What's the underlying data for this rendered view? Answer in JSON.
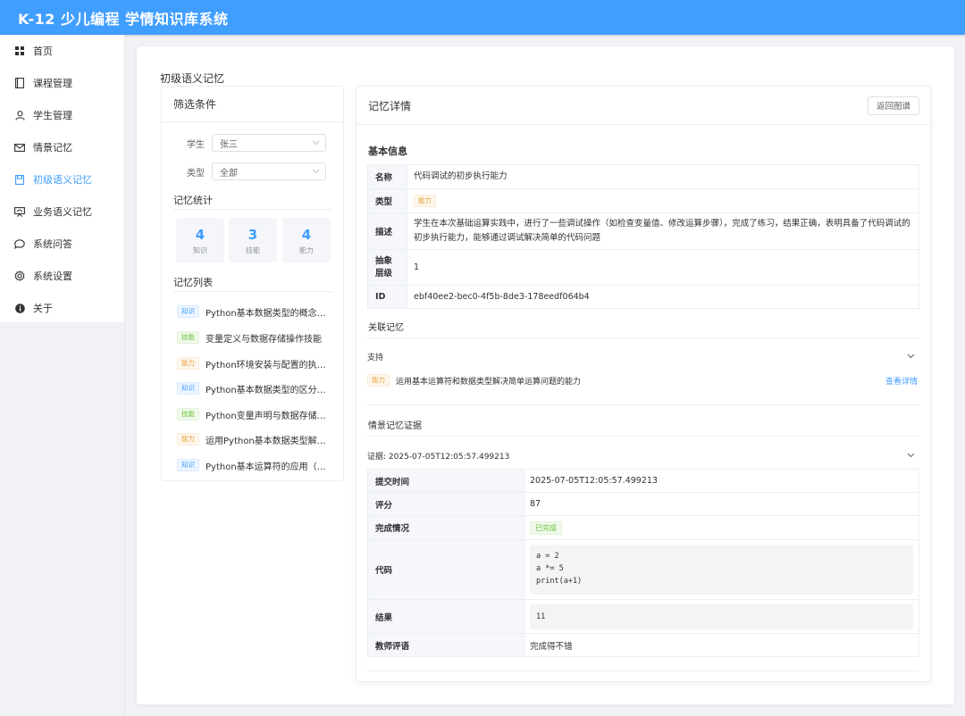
{
  "header": {
    "title": "K-12 少儿编程 学情知识库系统"
  },
  "sidebar": {
    "items": [
      {
        "label": "首页",
        "icon": "grid-icon",
        "active": false
      },
      {
        "label": "课程管理",
        "icon": "book-icon",
        "active": false
      },
      {
        "label": "学生管理",
        "icon": "user-icon",
        "active": false
      },
      {
        "label": "情景记忆",
        "icon": "mail-icon",
        "active": false
      },
      {
        "label": "初级语义记忆",
        "icon": "save-icon",
        "active": true
      },
      {
        "label": "业务语义记忆",
        "icon": "presentation-icon",
        "active": false
      },
      {
        "label": "系统问答",
        "icon": "chat-icon",
        "active": false
      },
      {
        "label": "系统设置",
        "icon": "gear-icon",
        "active": false
      },
      {
        "label": "关于",
        "icon": "info-icon",
        "active": false
      }
    ]
  },
  "page": {
    "title": "初级语义记忆"
  },
  "filter": {
    "title": "筛选条件",
    "student_label": "学生",
    "student_value": "张三",
    "type_label": "类型",
    "type_value": "全部"
  },
  "stats": {
    "title": "记忆统计",
    "items": [
      {
        "value": "4",
        "label": "知识"
      },
      {
        "value": "3",
        "label": "技能"
      },
      {
        "value": "4",
        "label": "能力"
      }
    ]
  },
  "memory_list": {
    "title": "记忆列表",
    "items": [
      {
        "tag": "知识",
        "kind": "k",
        "text": "Python基本数据类型的概念与..."
      },
      {
        "tag": "技能",
        "kind": "s",
        "text": "变量定义与数据存储操作技能"
      },
      {
        "tag": "能力",
        "kind": "a",
        "text": "Python环境安装与配置的执行..."
      },
      {
        "tag": "知识",
        "kind": "k",
        "text": "Python基本数据类型的区分与..."
      },
      {
        "tag": "技能",
        "kind": "s",
        "text": "Python变量声明与数据存储操作"
      },
      {
        "tag": "能力",
        "kind": "a",
        "text": "运用Python基本数据类型解决..."
      },
      {
        "tag": "知识",
        "kind": "k",
        "text": "Python基本运算符的应用（数..."
      }
    ]
  },
  "detail": {
    "title": "记忆详情",
    "back_button": "返回图谱",
    "basic_title": "基本信息",
    "basic": {
      "name_label": "名称",
      "name_value": "代码调试的初步执行能力",
      "type_label": "类型",
      "type_value": "能力",
      "desc_label": "描述",
      "desc_value": "学生在本次基础运算实践中，进行了一些调试操作（如检查变量值、修改运算步骤），完成了练习，结果正确，表明具备了代码调试的初步执行能力，能够通过调试解决简单的代码问题",
      "level_label": "抽象层级",
      "level_value": "1",
      "id_label": "ID",
      "id_value": "ebf40ee2-bec0-4f5b-8de3-178eedf064b4"
    },
    "related_title": "关联记忆",
    "related_group": "支持",
    "related_tag": "能力",
    "related_text": "运用基本运算符和数据类型解决简单运算问题的能力",
    "related_link": "查看详情",
    "evidence_title": "情景记忆证据",
    "evidence_group": "证据: 2025-07-05T12:05:57.499213",
    "evidence": {
      "submit_label": "提交时间",
      "submit_value": "2025-07-05T12:05:57.499213",
      "score_label": "评分",
      "score_value": "87",
      "status_label": "完成情况",
      "status_value": "已完成",
      "code_label": "代码",
      "code_value": "a = 2\na *= 5\nprint(a+1)",
      "result_label": "结果",
      "result_value": "11",
      "comment_label": "教师评语",
      "comment_value": "完成得不错"
    }
  },
  "colors": {
    "primary": "#409eff",
    "success": "#67c23a",
    "warning": "#e6a23c"
  }
}
